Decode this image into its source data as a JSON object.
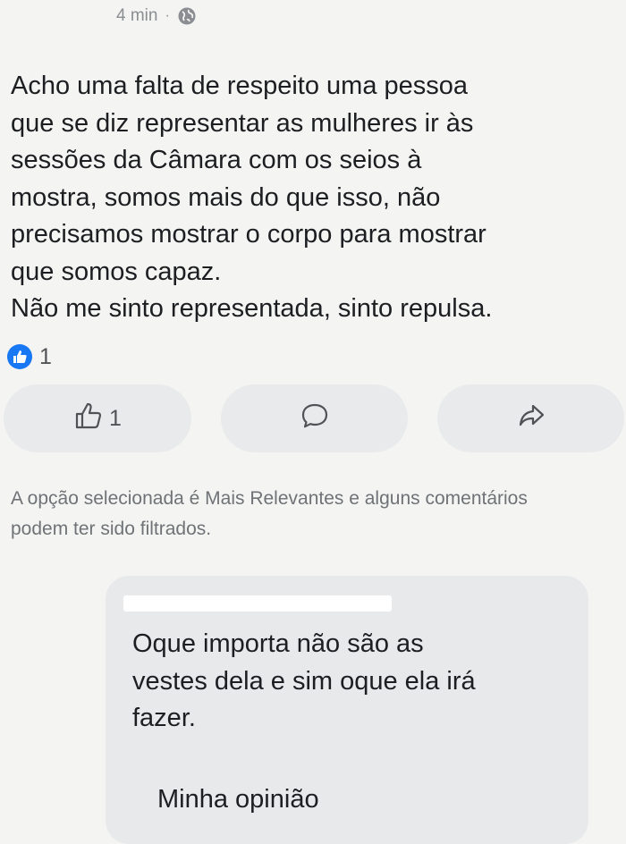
{
  "post": {
    "timestamp": "4 min",
    "separator": "·",
    "audience_icon": "globe-icon",
    "text": "Acho uma falta de respeito uma pessoa\nque se diz representar as mulheres ir às\nsessões da Câmara com os seios à\nmostra, somos mais do que isso, não\nprecisamos mostrar o corpo para mostrar\nque somos capaz.\nNão me sinto representada, sinto repulsa.",
    "reaction_count": "1"
  },
  "actions": {
    "like_icon": "thumbs-up-icon",
    "like_count": "1",
    "comment_icon": "comment-bubble-icon",
    "share_icon": "share-arrow-icon"
  },
  "filter_note": "A opção selecionada é Mais Relevantes e alguns comentários podem ter sido filtrados.",
  "comment": {
    "text": "Oque importa não são as\nvestes dela e sim oque ela irá\nfazer.",
    "extra_line": "Minha opinião"
  },
  "colors": {
    "background": "#f4f4f3",
    "accent": "#1877f2",
    "pill": "#e9eaec",
    "muted_text": "#6f7276"
  }
}
